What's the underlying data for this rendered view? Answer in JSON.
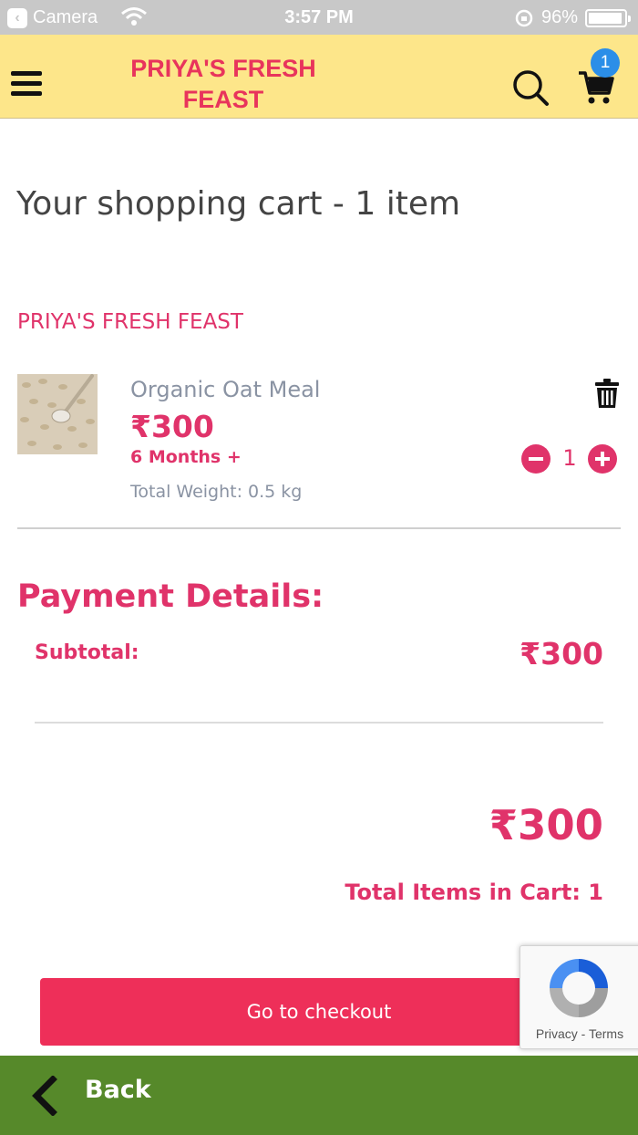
{
  "status_bar": {
    "back_app": "Camera",
    "time": "3:57 PM",
    "battery_percent": "96%",
    "battery_level": 0.96
  },
  "header": {
    "brand_line1": "PRIYA'S FRESH",
    "brand_line2": "FEAST",
    "cart_count": "1",
    "icons": [
      "menu-icon",
      "search-icon",
      "cart-icon"
    ],
    "background_color": "#fde68a",
    "brand_color": "#e8345c",
    "badge_color": "#2b8ee8"
  },
  "cart": {
    "title": "Your shopping cart - 1 item",
    "store_name": "PRIYA'S FRESH FEAST",
    "items": [
      {
        "name": "Organic Oat Meal",
        "price": "₹300",
        "age": "6 Months +",
        "weight": "Total Weight: 0.5 kg",
        "quantity": "1"
      }
    ]
  },
  "payment": {
    "title": "Payment Details:",
    "subtotal_label": "Subtotal:",
    "subtotal_value": "₹300",
    "total_value": "₹300",
    "total_items": "Total Items in Cart: 1"
  },
  "checkout": {
    "label": "Go to checkout",
    "color": "#ee2f59"
  },
  "recaptcha": {
    "links": "Privacy - Terms"
  },
  "footer": {
    "back_label": "Back",
    "color": "#56892a"
  },
  "accent_color": "#e0336a"
}
